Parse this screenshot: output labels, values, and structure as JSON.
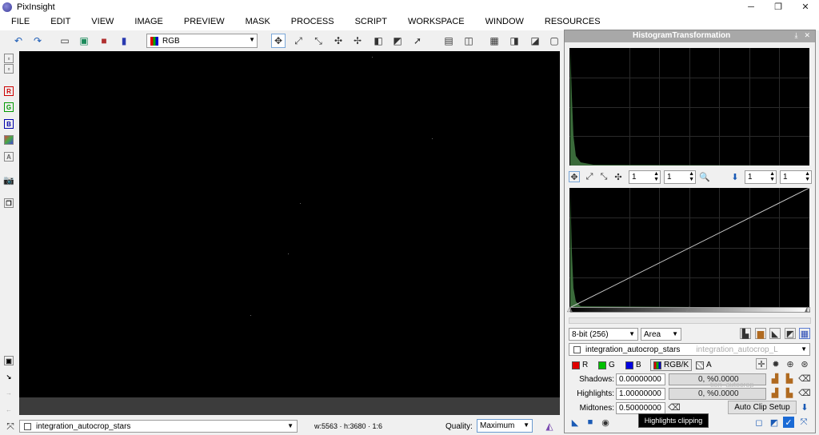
{
  "app": {
    "title": "PixInsight"
  },
  "window_buttons": {
    "minimize": "─",
    "restore": "❐",
    "close": "✕"
  },
  "menu": [
    "FILE",
    "EDIT",
    "VIEW",
    "IMAGE",
    "PREVIEW",
    "MASK",
    "PROCESS",
    "SCRIPT",
    "WORKSPACE",
    "WINDOW",
    "RESOURCES"
  ],
  "toolbar": {
    "channel_select": "RGB"
  },
  "left_strip": {
    "r": "R",
    "g": "G",
    "b": "B",
    "a": "A"
  },
  "status": {
    "view_name": "integration_autocrop_stars",
    "dimensions": "w:5563 · h:3680 · 1:6",
    "quality_label": "Quality:",
    "quality_value": "Maximum"
  },
  "histogram": {
    "title": "HistogramTransformation",
    "zoom_x_top": "1",
    "zoom_y_top": "1",
    "zoom_x_right": "1",
    "zoom_y_right": "1",
    "resolution": "8-bit (256)",
    "plot_mode": "Area",
    "view_select": "integration_autocrop_stars",
    "ghost_view": "integration_autocrop_L",
    "ghost_view2": "tion_autocrop",
    "channels": {
      "r": "R",
      "g": "G",
      "b": "B",
      "rgbk": "RGB/K",
      "a": "A"
    },
    "channel_colors": {
      "r": "#e00000",
      "g": "#00c000",
      "b": "#0000e0"
    },
    "shadows_label": "Shadows:",
    "shadows_value": "0.00000000",
    "shadows_clip": "0, %0.0000",
    "highlights_label": "Highlights:",
    "highlights_value": "1.00000000",
    "highlights_clip": "0, %0.0000",
    "midtones_label": "Midtones:",
    "midtones_value": "0.50000000",
    "auto_clip_button": "Auto Clip Setup",
    "tooltip": "Highlights clipping"
  }
}
